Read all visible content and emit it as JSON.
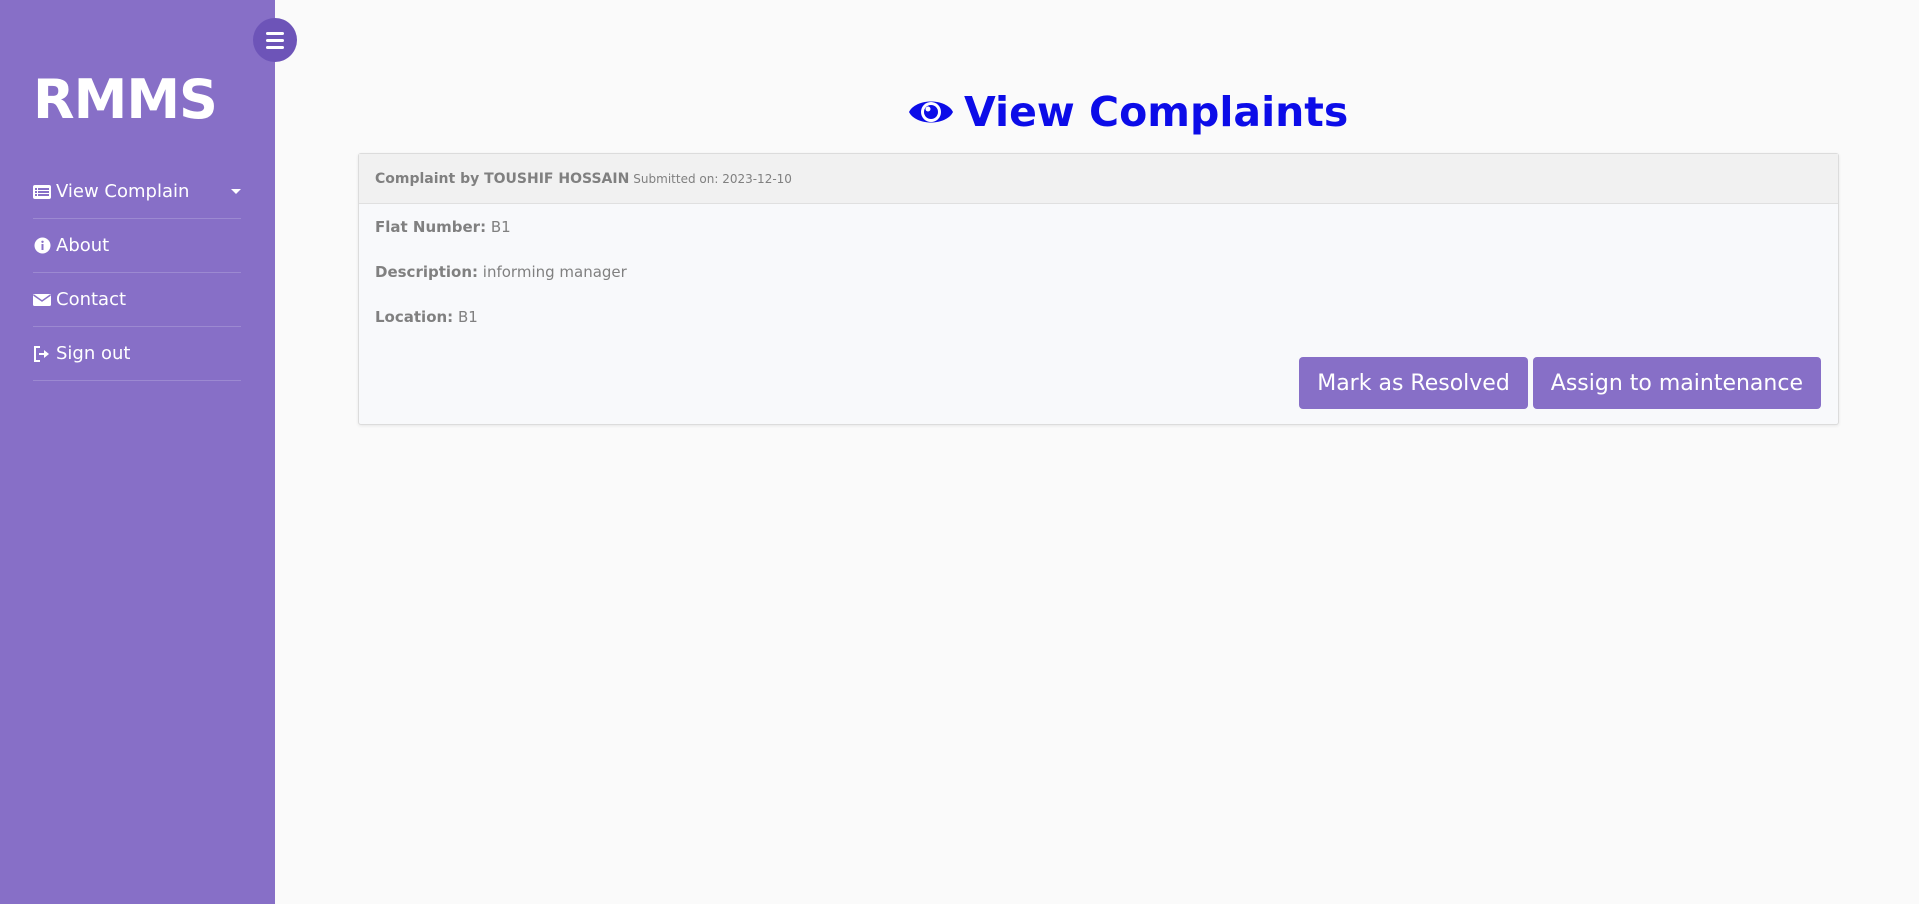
{
  "sidebar": {
    "brand": "RMMS",
    "items": [
      {
        "label": "View Complain",
        "icon": "list-icon",
        "has_dropdown": true
      },
      {
        "label": "About",
        "icon": "info-icon"
      },
      {
        "label": "Contact",
        "icon": "envelope-icon"
      },
      {
        "label": "Sign out",
        "icon": "sign-out-icon"
      }
    ]
  },
  "page": {
    "title": "View Complaints",
    "title_icon": "eye-icon"
  },
  "complaint": {
    "header_prefix": "Complaint by TOUSHIF HOSSAIN",
    "submitted": "Submitted on: 2023-12-10",
    "flat_label": "Flat Number:",
    "flat_value": "B1",
    "description_label": "Description:",
    "description_value": "informing manager",
    "location_label": "Location:",
    "location_value": "B1",
    "resolve_button": "Mark as Resolved",
    "assign_button": "Assign to maintenance"
  },
  "colors": {
    "sidebar": "#876fc7",
    "accent_title": "#0c0ce8",
    "button": "#876fc7"
  }
}
